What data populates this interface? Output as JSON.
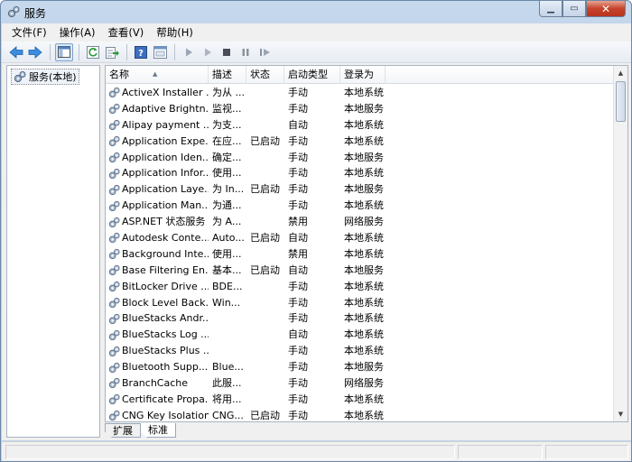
{
  "window": {
    "title": "服务"
  },
  "menu": [
    {
      "label": "文件(F)"
    },
    {
      "label": "操作(A)"
    },
    {
      "label": "查看(V)"
    },
    {
      "label": "帮助(H)"
    }
  ],
  "tree": {
    "root_label": "服务(本地)"
  },
  "columns": {
    "name": "名称",
    "desc": "描述",
    "status": "状态",
    "startup": "启动类型",
    "logon": "登录为"
  },
  "services": [
    {
      "name": "ActiveX Installer ...",
      "desc": "为从 ...",
      "status": "",
      "startup": "手动",
      "logon": "本地系统"
    },
    {
      "name": "Adaptive Brightn...",
      "desc": "监视...",
      "status": "",
      "startup": "手动",
      "logon": "本地服务"
    },
    {
      "name": "Alipay payment ...",
      "desc": "为支...",
      "status": "",
      "startup": "自动",
      "logon": "本地系统"
    },
    {
      "name": "Application Expe...",
      "desc": "在应...",
      "status": "已启动",
      "startup": "手动",
      "logon": "本地系统"
    },
    {
      "name": "Application Iden...",
      "desc": "确定...",
      "status": "",
      "startup": "手动",
      "logon": "本地服务"
    },
    {
      "name": "Application Infor...",
      "desc": "使用...",
      "status": "",
      "startup": "手动",
      "logon": "本地系统"
    },
    {
      "name": "Application Laye...",
      "desc": "为 In...",
      "status": "已启动",
      "startup": "手动",
      "logon": "本地服务"
    },
    {
      "name": "Application Man...",
      "desc": "为通...",
      "status": "",
      "startup": "手动",
      "logon": "本地系统"
    },
    {
      "name": "ASP.NET 状态服务",
      "desc": "为 A...",
      "status": "",
      "startup": "禁用",
      "logon": "网络服务"
    },
    {
      "name": "Autodesk Conte...",
      "desc": "Auto...",
      "status": "已启动",
      "startup": "自动",
      "logon": "本地系统"
    },
    {
      "name": "Background Inte...",
      "desc": "使用...",
      "status": "",
      "startup": "禁用",
      "logon": "本地系统"
    },
    {
      "name": "Base Filtering En...",
      "desc": "基本...",
      "status": "已启动",
      "startup": "自动",
      "logon": "本地服务"
    },
    {
      "name": "BitLocker Drive ...",
      "desc": "BDE...",
      "status": "",
      "startup": "手动",
      "logon": "本地系统"
    },
    {
      "name": "Block Level Back...",
      "desc": "Win...",
      "status": "",
      "startup": "手动",
      "logon": "本地系统"
    },
    {
      "name": "BlueStacks Andr...",
      "desc": "",
      "status": "",
      "startup": "手动",
      "logon": "本地系统"
    },
    {
      "name": "BlueStacks Log ...",
      "desc": "",
      "status": "",
      "startup": "自动",
      "logon": "本地系统"
    },
    {
      "name": "BlueStacks Plus ...",
      "desc": "",
      "status": "",
      "startup": "手动",
      "logon": "本地系统"
    },
    {
      "name": "Bluetooth Supp...",
      "desc": "Blue...",
      "status": "",
      "startup": "手动",
      "logon": "本地服务"
    },
    {
      "name": "BranchCache",
      "desc": "此服...",
      "status": "",
      "startup": "手动",
      "logon": "网络服务"
    },
    {
      "name": "Certificate Propa...",
      "desc": "将用...",
      "status": "",
      "startup": "手动",
      "logon": "本地系统"
    },
    {
      "name": "CNG Key Isolation",
      "desc": "CNG...",
      "status": "已启动",
      "startup": "手动",
      "logon": "本地系统"
    }
  ],
  "tabs": [
    {
      "label": "扩展"
    },
    {
      "label": "标准"
    }
  ]
}
